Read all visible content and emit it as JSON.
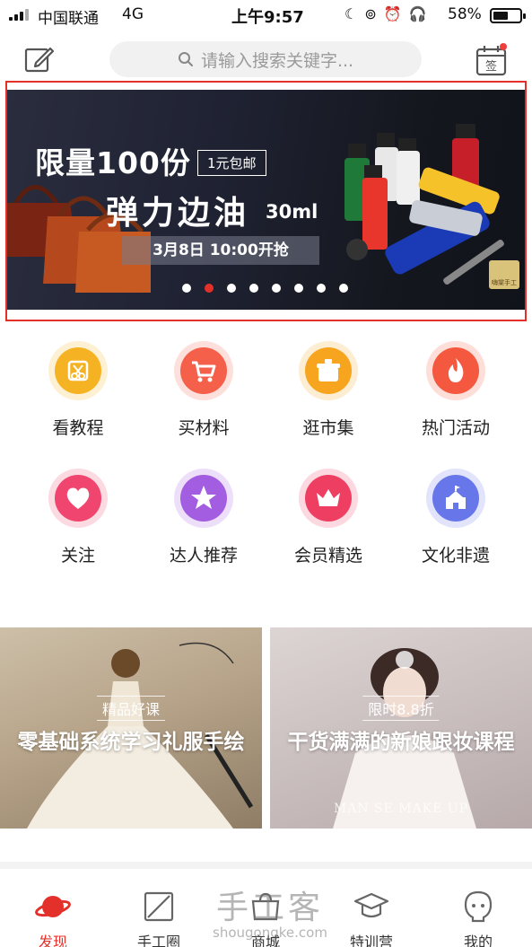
{
  "status_bar": {
    "carrier": "中国联通",
    "network": "4G",
    "time": "上午9:57",
    "battery": "58%",
    "battery_level": 0.58
  },
  "header": {
    "search_placeholder": "请输入搜索关键字...",
    "sign_label": "签"
  },
  "banner": {
    "title_line1": "限量100份",
    "tag": "1元包邮",
    "title_line2": "弹力边油",
    "size": "30ml",
    "date": "3月8日 10:00开抢",
    "logo_text": "嗨棠手工",
    "slide_count": 8,
    "active_slide": 1
  },
  "categories": [
    {
      "label": "看教程",
      "icon": "scissors-icon",
      "color": "#f5b323"
    },
    {
      "label": "买材料",
      "icon": "cart-icon",
      "color": "#f4604a"
    },
    {
      "label": "逛市集",
      "icon": "basket-icon",
      "color": "#f7a51f"
    },
    {
      "label": "热门活动",
      "icon": "flame-icon",
      "color": "#f4583f"
    },
    {
      "label": "关注",
      "icon": "heart-icon",
      "color": "#f0456e"
    },
    {
      "label": "达人推荐",
      "icon": "star-icon",
      "color": "#a35de0"
    },
    {
      "label": "会员精选",
      "icon": "crown-icon",
      "color": "#ee3f63"
    },
    {
      "label": "文化非遗",
      "icon": "building-icon",
      "color": "#6777ea"
    }
  ],
  "courses": [
    {
      "tag": "精品好课",
      "title": "零基础系统学习礼服手绘"
    },
    {
      "tag": "限时8.8折",
      "title": "干货满满的新娘跟妆课程",
      "watermark": "MAN SE MAKE UP"
    }
  ],
  "tabs": [
    {
      "label": "发现",
      "icon": "planet-icon",
      "active": true
    },
    {
      "label": "手工圈",
      "icon": "square-slash-icon",
      "active": false
    },
    {
      "label": "商城",
      "icon": "shop-icon",
      "active": false
    },
    {
      "label": "特训营",
      "icon": "graduation-cap-icon",
      "active": false
    },
    {
      "label": "我的",
      "icon": "face-icon",
      "active": false
    }
  ],
  "site_watermark": {
    "cn": "手工客",
    "en": "shougongke.com"
  },
  "colors": {
    "accent": "#e4302b",
    "banner_bg": "#1f2232"
  }
}
